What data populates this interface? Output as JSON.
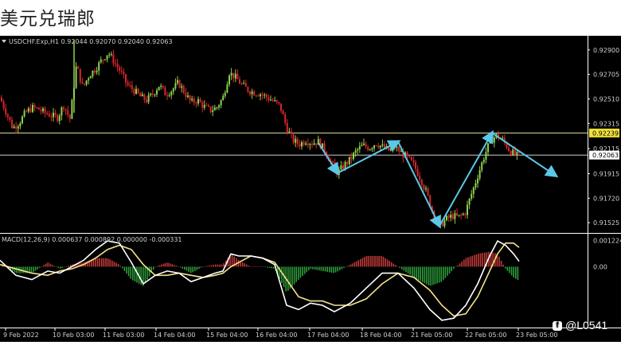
{
  "page_title": "美元兑瑞郎",
  "credit": {
    "icon": "facebook-icon",
    "text": "@L0541"
  },
  "colors": {
    "background": "#000000",
    "bull_candle": "#8fd14f",
    "bear_candle": "#d8262b",
    "macd_line": "#ffffff",
    "signal_line": "#f5e48a",
    "hist_positive": "#c33a3a",
    "hist_negative": "#2e9c3a",
    "arrows": "#5cc7e6",
    "bid_line": "#e8e8a0"
  },
  "chart_data": {
    "type": "candlestick",
    "title": "USDCHF.Exp,H1  0.92044 0.92070 0.92040 0.92063",
    "price_ticks": [
      "0.92900",
      "0.92705",
      "0.92510",
      "0.92315",
      "0.92115",
      "0.91915",
      "0.91720",
      "0.91525"
    ],
    "ylim": [
      0.9145,
      0.93
    ],
    "price_markers": [
      {
        "label": "0.92239",
        "value": 0.92239
      },
      {
        "label": "0.92063",
        "value": 0.92063
      }
    ],
    "time_labels": [
      "9 Feb 2022",
      "10 Feb 03:00",
      "11 Feb 03:00",
      "14 Feb 04:00",
      "15 Feb 04:00",
      "16 Feb 04:00",
      "17 Feb 04:00",
      "18 Feb 04:00",
      "21 Feb 05:00",
      "22 Feb 05:00",
      "23 Feb 05:00"
    ],
    "price_path": [
      [
        0,
        0.9252
      ],
      [
        8,
        0.924
      ],
      [
        16,
        0.9228
      ],
      [
        24,
        0.9232
      ],
      [
        32,
        0.924
      ],
      [
        40,
        0.9244
      ],
      [
        48,
        0.9243
      ],
      [
        56,
        0.924
      ],
      [
        64,
        0.9238
      ],
      [
        72,
        0.9236
      ],
      [
        80,
        0.9246
      ],
      [
        88,
        0.9235
      ],
      [
        96,
        0.9278
      ],
      [
        104,
        0.926
      ],
      [
        112,
        0.927
      ],
      [
        120,
        0.9275
      ],
      [
        128,
        0.9282
      ],
      [
        136,
        0.9288
      ],
      [
        144,
        0.928
      ],
      [
        152,
        0.9272
      ],
      [
        160,
        0.9262
      ],
      [
        168,
        0.9258
      ],
      [
        176,
        0.9253
      ],
      [
        184,
        0.925
      ],
      [
        192,
        0.9255
      ],
      [
        200,
        0.9262
      ],
      [
        208,
        0.9255
      ],
      [
        216,
        0.9258
      ],
      [
        224,
        0.9264
      ],
      [
        232,
        0.9256
      ],
      [
        240,
        0.9248
      ],
      [
        248,
        0.925
      ],
      [
        256,
        0.9245
      ],
      [
        264,
        0.9242
      ],
      [
        272,
        0.9244
      ],
      [
        280,
        0.9252
      ],
      [
        288,
        0.9272
      ],
      [
        296,
        0.9268
      ],
      [
        304,
        0.9262
      ],
      [
        312,
        0.9258
      ],
      [
        320,
        0.9256
      ],
      [
        328,
        0.9255
      ],
      [
        336,
        0.9252
      ],
      [
        344,
        0.9249
      ],
      [
        352,
        0.9245
      ],
      [
        360,
        0.9228
      ],
      [
        368,
        0.9218
      ],
      [
        376,
        0.9215
      ],
      [
        384,
        0.9218
      ],
      [
        392,
        0.9216
      ],
      [
        400,
        0.9217
      ],
      [
        408,
        0.921
      ],
      [
        416,
        0.92
      ],
      [
        424,
        0.9192
      ],
      [
        432,
        0.9198
      ],
      [
        440,
        0.9203
      ],
      [
        448,
        0.921
      ],
      [
        456,
        0.9214
      ],
      [
        464,
        0.9212
      ],
      [
        472,
        0.9216
      ],
      [
        480,
        0.9213
      ],
      [
        488,
        0.921
      ],
      [
        496,
        0.9213
      ],
      [
        504,
        0.9208
      ],
      [
        512,
        0.9204
      ],
      [
        520,
        0.9198
      ],
      [
        528,
        0.9188
      ],
      [
        536,
        0.9176
      ],
      [
        544,
        0.916
      ],
      [
        552,
        0.915
      ],
      [
        560,
        0.9155
      ],
      [
        568,
        0.9158
      ],
      [
        576,
        0.9157
      ],
      [
        584,
        0.916
      ],
      [
        592,
        0.9175
      ],
      [
        600,
        0.919
      ],
      [
        608,
        0.9205
      ],
      [
        616,
        0.9218
      ],
      [
        624,
        0.9222
      ],
      [
        632,
        0.9218
      ],
      [
        640,
        0.921
      ],
      [
        648,
        0.9206
      ],
      [
        654,
        0.92063
      ]
    ],
    "arrows": [
      {
        "from": [
          400,
          0.9216
        ],
        "to": [
          424,
          0.9192
        ]
      },
      {
        "from": [
          424,
          0.9192
        ],
        "to": [
          500,
          0.9217
        ]
      },
      {
        "from": [
          500,
          0.9217
        ],
        "to": [
          552,
          0.915
        ]
      },
      {
        "from": [
          552,
          0.915
        ],
        "to": [
          618,
          0.92239
        ]
      },
      {
        "from": [
          618,
          0.92239
        ],
        "to": [
          698,
          0.919
        ]
      }
    ],
    "macd": {
      "label": "MACD(12,26,9) 0.000637 0.000892 0.000000 -0.000331",
      "ticks": [
        "0.001224",
        "0.00"
      ],
      "ylim": [
        -0.0028,
        0.0015
      ],
      "macd_path": [
        [
          0,
          0.0003
        ],
        [
          20,
          -0.0004
        ],
        [
          40,
          -0.0006
        ],
        [
          60,
          -0.0002
        ],
        [
          75,
          -0.0003
        ],
        [
          90,
          0.0
        ],
        [
          105,
          0.0003
        ],
        [
          120,
          0.0008
        ],
        [
          135,
          0.0012
        ],
        [
          150,
          0.0011
        ],
        [
          165,
          0.0002
        ],
        [
          180,
          -0.0008
        ],
        [
          195,
          -0.0004
        ],
        [
          210,
          -0.0002
        ],
        [
          225,
          -0.0003
        ],
        [
          240,
          -0.0007
        ],
        [
          255,
          -0.0005
        ],
        [
          270,
          -0.0003
        ],
        [
          280,
          -0.0002
        ],
        [
          290,
          0.0006
        ],
        [
          300,
          0.0005
        ],
        [
          315,
          0.0005
        ],
        [
          330,
          0.0004
        ],
        [
          345,
          0.0001
        ],
        [
          360,
          -0.0018
        ],
        [
          375,
          -0.002
        ],
        [
          390,
          -0.0017
        ],
        [
          405,
          -0.0018
        ],
        [
          420,
          -0.0021
        ],
        [
          440,
          -0.0017
        ],
        [
          460,
          -0.001
        ],
        [
          480,
          -0.0003
        ],
        [
          500,
          -0.0003
        ],
        [
          520,
          -0.001
        ],
        [
          540,
          -0.002
        ],
        [
          555,
          -0.0025
        ],
        [
          570,
          -0.0024
        ],
        [
          585,
          -0.0018
        ],
        [
          600,
          -0.0008
        ],
        [
          615,
          0.0005
        ],
        [
          625,
          0.0012
        ],
        [
          635,
          0.001
        ],
        [
          645,
          0.0006
        ],
        [
          652,
          0.00025
        ]
      ],
      "signal_path": [
        [
          0,
          0.0001
        ],
        [
          20,
          -0.0001
        ],
        [
          40,
          -0.0003
        ],
        [
          60,
          -0.0004
        ],
        [
          75,
          -0.0002
        ],
        [
          90,
          -0.0001
        ],
        [
          105,
          0.0001
        ],
        [
          120,
          0.0004
        ],
        [
          135,
          0.0008
        ],
        [
          150,
          0.001
        ],
        [
          165,
          0.0008
        ],
        [
          180,
          0.0001
        ],
        [
          195,
          -0.0004
        ],
        [
          210,
          -0.0004
        ],
        [
          225,
          -0.0003
        ],
        [
          240,
          -0.0004
        ],
        [
          255,
          -0.0005
        ],
        [
          270,
          -0.0004
        ],
        [
          280,
          -0.0003
        ],
        [
          290,
          0.0
        ],
        [
          300,
          0.0002
        ],
        [
          315,
          0.0005
        ],
        [
          330,
          0.0004
        ],
        [
          345,
          0.0002
        ],
        [
          360,
          -0.0006
        ],
        [
          375,
          -0.0014
        ],
        [
          390,
          -0.0016
        ],
        [
          405,
          -0.0016
        ],
        [
          420,
          -0.0018
        ],
        [
          440,
          -0.0018
        ],
        [
          460,
          -0.0015
        ],
        [
          480,
          -0.0008
        ],
        [
          500,
          -0.0003
        ],
        [
          520,
          -0.0005
        ],
        [
          540,
          -0.0011
        ],
        [
          555,
          -0.0018
        ],
        [
          570,
          -0.0023
        ],
        [
          585,
          -0.0022
        ],
        [
          600,
          -0.0014
        ],
        [
          615,
          -0.0002
        ],
        [
          625,
          0.0006
        ],
        [
          635,
          0.0011
        ],
        [
          645,
          0.0011
        ],
        [
          652,
          0.0009
        ]
      ]
    }
  }
}
